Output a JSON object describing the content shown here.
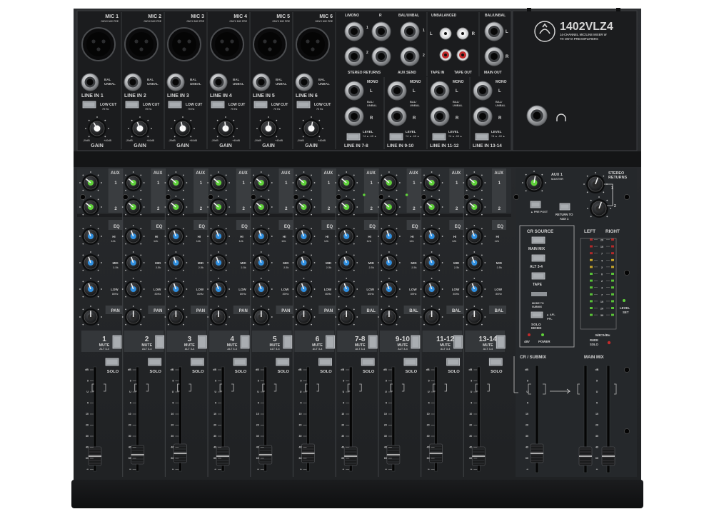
{
  "model": "1402VLZ4",
  "subtitle": "14-CHANNEL MIC/LINE MIXER WITH ONYX PREAMPLIFIERS",
  "mono_channels": [
    {
      "mic": "MIC 1",
      "line": "LINE IN 1",
      "strip": "1"
    },
    {
      "mic": "MIC 2",
      "line": "LINE IN 2",
      "strip": "2"
    },
    {
      "mic": "MIC 3",
      "line": "LINE IN 3",
      "strip": "3"
    },
    {
      "mic": "MIC 4",
      "line": "LINE IN 4",
      "strip": "4"
    },
    {
      "mic": "MIC 5",
      "line": "LINE IN 5",
      "strip": "5"
    },
    {
      "mic": "MIC 6",
      "line": "LINE IN 6",
      "strip": "6"
    }
  ],
  "stereo_channels": [
    {
      "line": "LINE IN 7-8",
      "strip": "7-8"
    },
    {
      "line": "LINE IN 9-10",
      "strip": "9-10"
    },
    {
      "line": "LINE IN 11-12",
      "strip": "11-12"
    },
    {
      "line": "LINE IN 13-14",
      "strip": "13-14"
    }
  ],
  "labels": {
    "onyx_mic_pre": "ONYX MIC PRE",
    "bal_unbal": "BAL / UNBAL",
    "low_cut": "LOW CUT",
    "low_cut_freq": "75 Hz",
    "gain": "GAIN",
    "gain_min": "-20dB",
    "gain_max": "+40dB",
    "l_mono": "L/MONO",
    "bal_unbal_short": "BAL/UNBAL",
    "unbalanced": "UNBALANCED",
    "stereo_returns": "STEREO RETURNS",
    "aux_send": "AUX SEND",
    "tape_in": "TAPE IN",
    "tape_out": "TAPE OUT",
    "main_out": "MAIN OUT",
    "mono": "MONO",
    "level": "LEVEL",
    "level_opts": "+4 ▲ -10 ▲",
    "aux": "AUX",
    "eq": "EQ",
    "hi": "HI",
    "hi_freq": "12k",
    "mid": "MID",
    "mid_freq": "2.5k",
    "low": "LOW",
    "low_freq": "80Hz",
    "pan": "PAN",
    "bal": "BAL",
    "mute": "MUTE",
    "alt": "ALT 3-4",
    "solo": "SOLO",
    "aux1_master": "AUX 1 MASTER",
    "stereo_returns_title": "STEREO RETURNS",
    "pre_post": "▲ PRE POST",
    "return_to_aux": "RETURN TO AUX 1",
    "cr_source": "CR SOURCE",
    "main_mix": "MAIN MIX",
    "alt34": "ALT 3-4",
    "tape": "TAPE",
    "mode_submix": "MODE TO SUBMIX",
    "solo_mode": "SOLO MODE",
    "afl": "▲ AFL",
    "pfl": "PFL",
    "v48": "48V",
    "power": "POWER",
    "left": "LEFT",
    "right": "RIGHT",
    "zero": "0dB=0dBu",
    "level_set": "LEVEL SET",
    "rude_solo": "RUDE SOLO",
    "cr_submix": "CR / SUBMIX",
    "main_mix_title": "MAIN MIX",
    "db": "dB",
    "u": "U"
  },
  "knob_colors": {
    "aux": "#5fd13a",
    "eq": "#2f8fe0",
    "pan": "#2a2a2a"
  },
  "meter_marks": [
    "20",
    "10",
    "7",
    "4",
    "2",
    "0",
    "2",
    "4",
    "7",
    "10",
    "20",
    "30"
  ]
}
